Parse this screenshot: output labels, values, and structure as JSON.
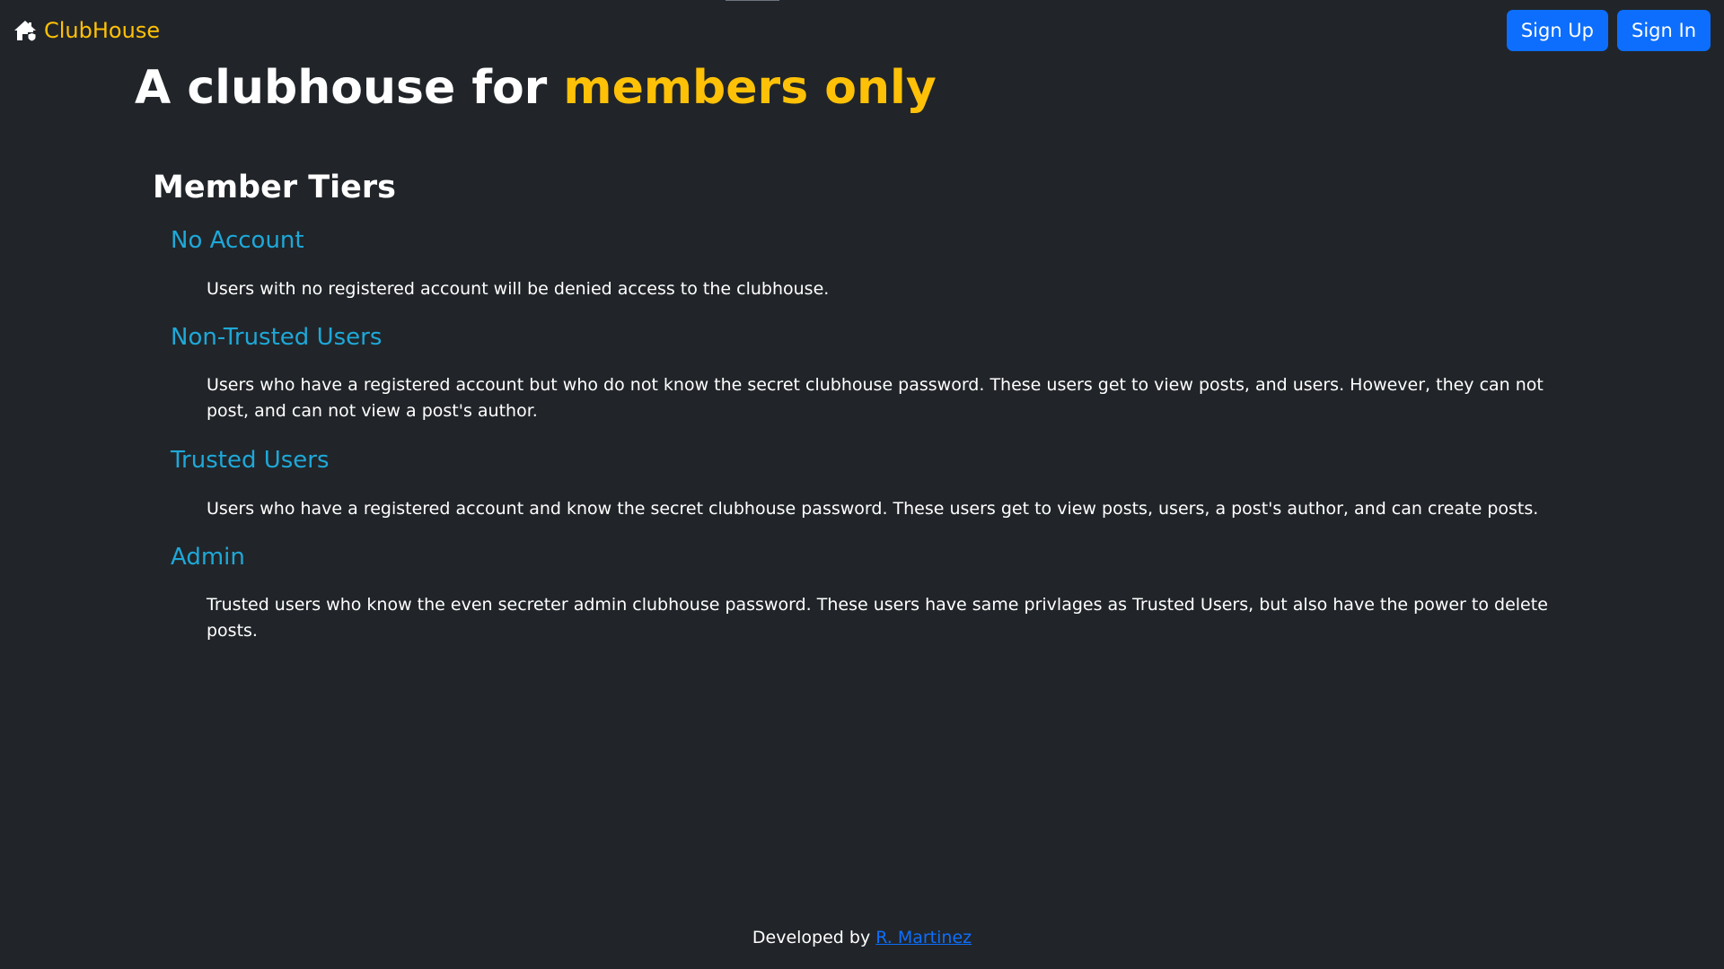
{
  "navbar": {
    "brand_name": "ClubHouse",
    "brand_icon": "house-icon",
    "sign_up_label": "Sign Up",
    "sign_in_label": "Sign In"
  },
  "hero": {
    "prefix": "A clubhouse for ",
    "accent": "members only"
  },
  "tiers": {
    "heading": "Member Tiers",
    "items": [
      {
        "title": "No Account",
        "description": "Users with no registered account will be denied access to the clubhouse."
      },
      {
        "title": "Non-Trusted Users",
        "description": "Users who have a registered account but who do not know the secret clubhouse password. These users get to view posts, and users. However, they can not post, and can not view a post's author."
      },
      {
        "title": "Trusted Users",
        "description": "Users who have a registered account and know the secret clubhouse password. These users get to view posts, users, a post's author, and can create posts."
      },
      {
        "title": "Admin",
        "description": "Trusted users who know the even secreter admin clubhouse password. These users have same privlages as Trusted Users, but also have the power to delete posts."
      }
    ]
  },
  "footer": {
    "prefix": "Developed by ",
    "author_link": "R. Martinez"
  },
  "colors": {
    "background": "#212529",
    "accent_yellow": "#ffc107",
    "tier_title_blue": "#1ea8d8",
    "button_blue": "#0d6efd",
    "link_blue": "#0d6efd"
  }
}
